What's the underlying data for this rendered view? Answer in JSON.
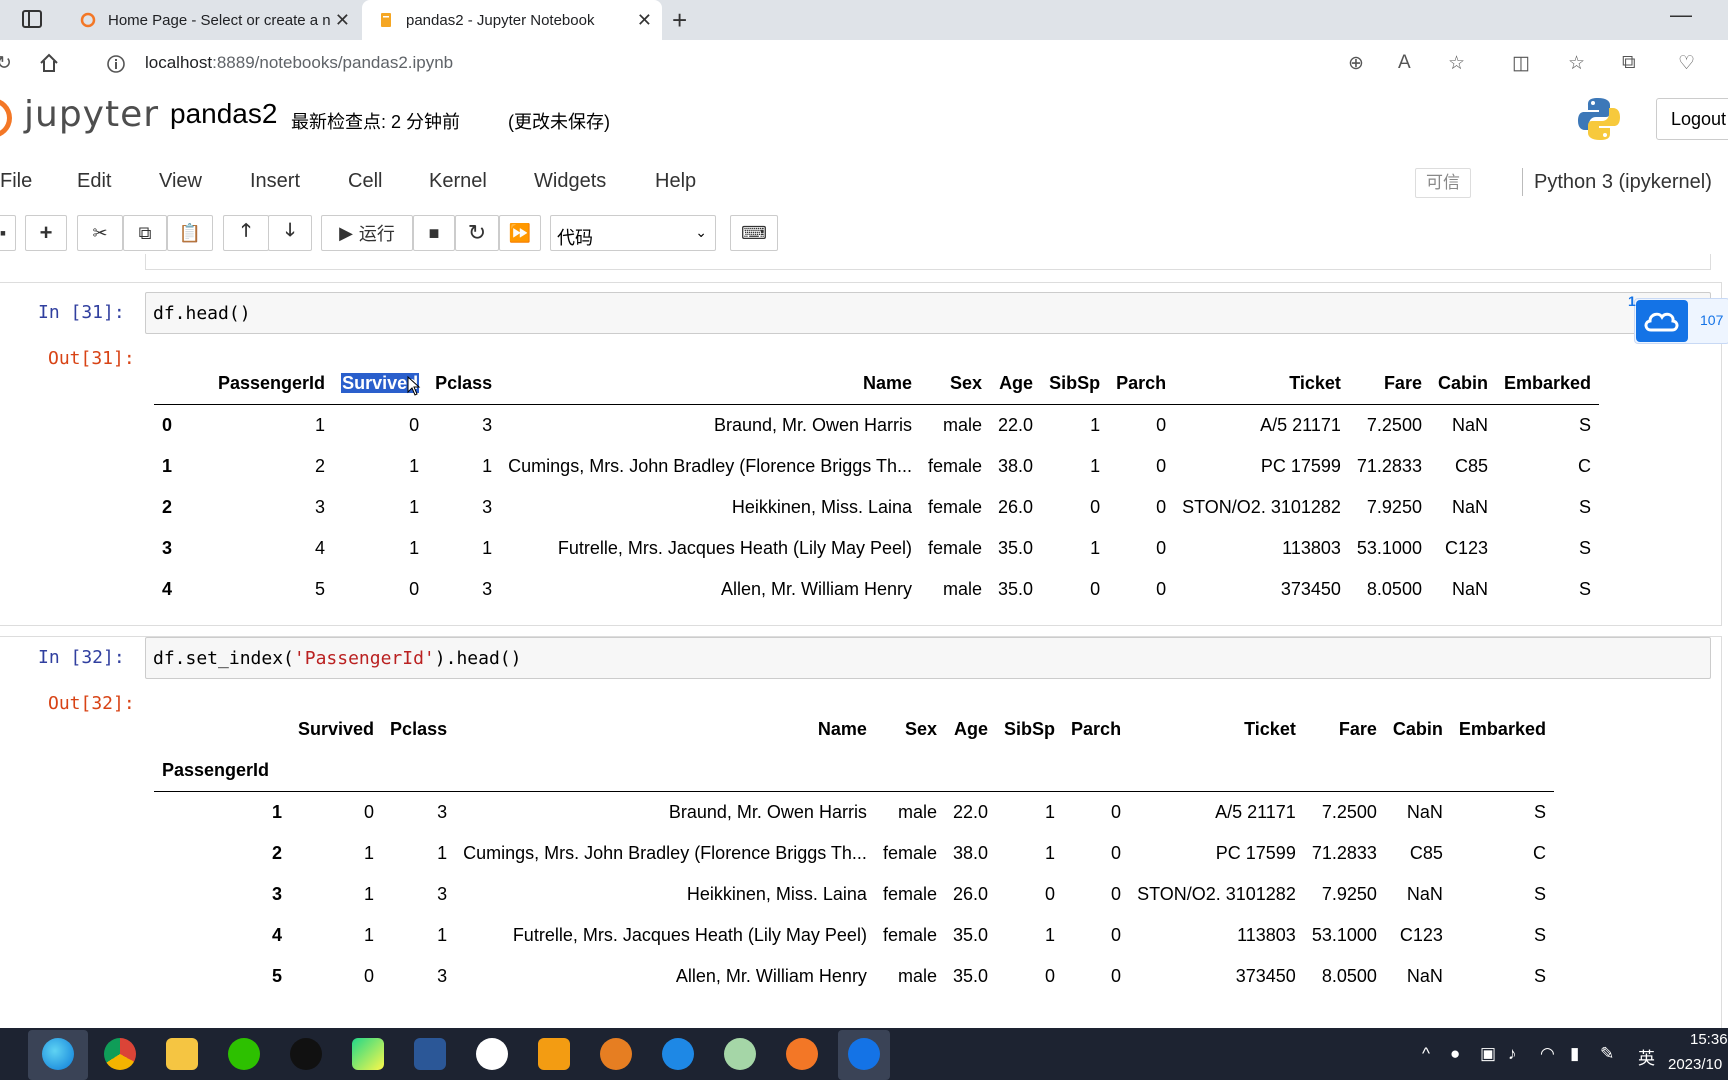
{
  "browser": {
    "tabs": [
      {
        "title": "Home Page - Select or create a n"
      },
      {
        "title": "pandas2 - Jupyter Notebook"
      }
    ],
    "address": {
      "host": "localhost",
      "path": ":8889/notebooks/pandas2.ipynb"
    }
  },
  "jupyter": {
    "logo_text": "jupyter",
    "notebook_name": "pandas2",
    "checkpoint": "最新检查点: 2 分钟前",
    "unsaved": "(更改未保存)",
    "logout": "Logout",
    "menu": [
      "File",
      "Edit",
      "View",
      "Insert",
      "Cell",
      "Kernel",
      "Widgets",
      "Help"
    ],
    "trusted": "可信",
    "kernel": "Python 3 (ipykernel)",
    "toolbar": {
      "run_label": "运行",
      "cell_type": "代码"
    }
  },
  "cells": [
    {
      "in_prompt": "In  [31]:",
      "out_prompt": "Out[31]:",
      "code": "df.head()",
      "table": {
        "columns": [
          "",
          "PassengerId",
          "Survived",
          "Pclass",
          "Name",
          "Sex",
          "Age",
          "SibSp",
          "Parch",
          "Ticket",
          "Fare",
          "Cabin",
          "Embarked"
        ],
        "rows": [
          [
            "0",
            "1",
            "0",
            "3",
            "Braund, Mr. Owen Harris",
            "male",
            "22.0",
            "1",
            "0",
            "A/5 21171",
            "7.2500",
            "NaN",
            "S"
          ],
          [
            "1",
            "2",
            "1",
            "1",
            "Cumings, Mrs. John Bradley (Florence Briggs Th...",
            "female",
            "38.0",
            "1",
            "0",
            "PC 17599",
            "71.2833",
            "C85",
            "C"
          ],
          [
            "2",
            "3",
            "1",
            "3",
            "Heikkinen, Miss. Laina",
            "female",
            "26.0",
            "0",
            "0",
            "STON/O2. 3101282",
            "7.9250",
            "NaN",
            "S"
          ],
          [
            "3",
            "4",
            "1",
            "1",
            "Futrelle, Mrs. Jacques Heath (Lily May Peel)",
            "female",
            "35.0",
            "1",
            "0",
            "113803",
            "53.1000",
            "C123",
            "S"
          ],
          [
            "4",
            "5",
            "0",
            "3",
            "Allen, Mr. William Henry",
            "male",
            "35.0",
            "0",
            "0",
            "373450",
            "8.0500",
            "NaN",
            "S"
          ]
        ]
      }
    },
    {
      "in_prompt": "In  [32]:",
      "out_prompt": "Out[32]:",
      "code_prefix": "df.set_index(",
      "code_string": "'PassengerId'",
      "code_suffix": ").head()",
      "table": {
        "columns": [
          "",
          "Survived",
          "Pclass",
          "Name",
          "Sex",
          "Age",
          "SibSp",
          "Parch",
          "Ticket",
          "Fare",
          "Cabin",
          "Embarked"
        ],
        "index_name": "PassengerId",
        "rows": [
          [
            "1",
            "0",
            "3",
            "Braund, Mr. Owen Harris",
            "male",
            "22.0",
            "1",
            "0",
            "A/5 21171",
            "7.2500",
            "NaN",
            "S"
          ],
          [
            "2",
            "1",
            "1",
            "Cumings, Mrs. John Bradley (Florence Briggs Th...",
            "female",
            "38.0",
            "1",
            "0",
            "PC 17599",
            "71.2833",
            "C85",
            "C"
          ],
          [
            "3",
            "1",
            "3",
            "Heikkinen, Miss. Laina",
            "female",
            "26.0",
            "0",
            "0",
            "STON/O2. 3101282",
            "7.9250",
            "NaN",
            "S"
          ],
          [
            "4",
            "1",
            "1",
            "Futrelle, Mrs. Jacques Heath (Lily May Peel)",
            "female",
            "35.0",
            "1",
            "0",
            "113803",
            "53.1000",
            "C123",
            "S"
          ],
          [
            "5",
            "0",
            "3",
            "Allen, Mr. William Henry",
            "male",
            "35.0",
            "0",
            "0",
            "373450",
            "8.0500",
            "NaN",
            "S"
          ]
        ]
      }
    }
  ],
  "cloud_widget": {
    "badge": "1",
    "count": "107"
  },
  "taskbar": {
    "time": "15:36",
    "date": "2023/10",
    "ime": "英"
  }
}
